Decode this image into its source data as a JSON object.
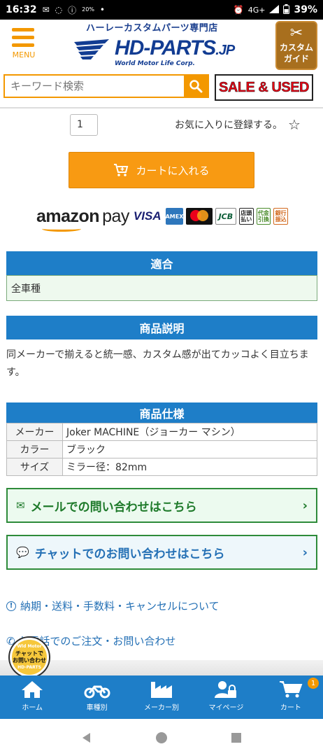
{
  "status_bar": {
    "time": "16:32",
    "battery_small": "20%",
    "network": "4G+",
    "battery": "39%"
  },
  "header": {
    "menu_label": "MENU",
    "tagline": "ハーレーカスタムパーツ専門店",
    "logo_main": "HD-PARTS",
    "logo_suffix": ".JP",
    "logo_sub": "World Motor Life Corp.",
    "custom_guide": [
      "カスタム",
      "ガイド"
    ]
  },
  "search": {
    "placeholder": "キーワード検索"
  },
  "sale_banner": "SALE & USED",
  "product": {
    "quantity": "1",
    "favorite_label": "お気に入りに登録する。",
    "cart_button": "カートに入れる"
  },
  "payments": {
    "amazon": "amazon",
    "pay": "pay",
    "visa": "VISA",
    "amex": "AMEX",
    "jcb": "JCB",
    "store": [
      "店頭",
      "払い"
    ],
    "cod": [
      "代金",
      "引換"
    ],
    "bank": [
      "銀行",
      "振込"
    ]
  },
  "compat": {
    "title": "適合",
    "value": "全車種"
  },
  "description": {
    "title": "商品説明",
    "text": "同メーカーで揃えると統一感、カスタム感が出てカッコよく目立ちます。"
  },
  "specs": {
    "title": "商品仕様",
    "rows": [
      {
        "key": "メーカー",
        "value": "Joker MACHINE（ジョーカー マシン）"
      },
      {
        "key": "カラー",
        "value": "ブラック"
      },
      {
        "key": "サイズ",
        "value": "ミラー径：82mm"
      }
    ]
  },
  "contact": {
    "mail": "メールでの問い合わせはこちら",
    "chat": "チャットでのお問い合わせはこちら"
  },
  "links": {
    "info": "納期・送料・手数料・キャンセルについて",
    "phone": "お電話でのご注文・お問い合わせ"
  },
  "chat_badge": {
    "top": "Wld Motor",
    "line1": "チャットで",
    "line2": "お問い合わせ",
    "bottom": "HD-PARTS"
  },
  "bottom_nav": {
    "items": [
      {
        "label": "ホーム",
        "icon": "home-icon"
      },
      {
        "label": "車種別",
        "icon": "motorcycle-icon"
      },
      {
        "label": "メーカー別",
        "icon": "factory-icon"
      },
      {
        "label": "マイページ",
        "icon": "user-lock-icon"
      },
      {
        "label": "カート",
        "icon": "cart-icon"
      }
    ],
    "cart_count": "1"
  },
  "colors": {
    "accent_orange": "#f39800",
    "brand_blue": "#1e7ec8",
    "contact_green": "#2e8b3a"
  }
}
